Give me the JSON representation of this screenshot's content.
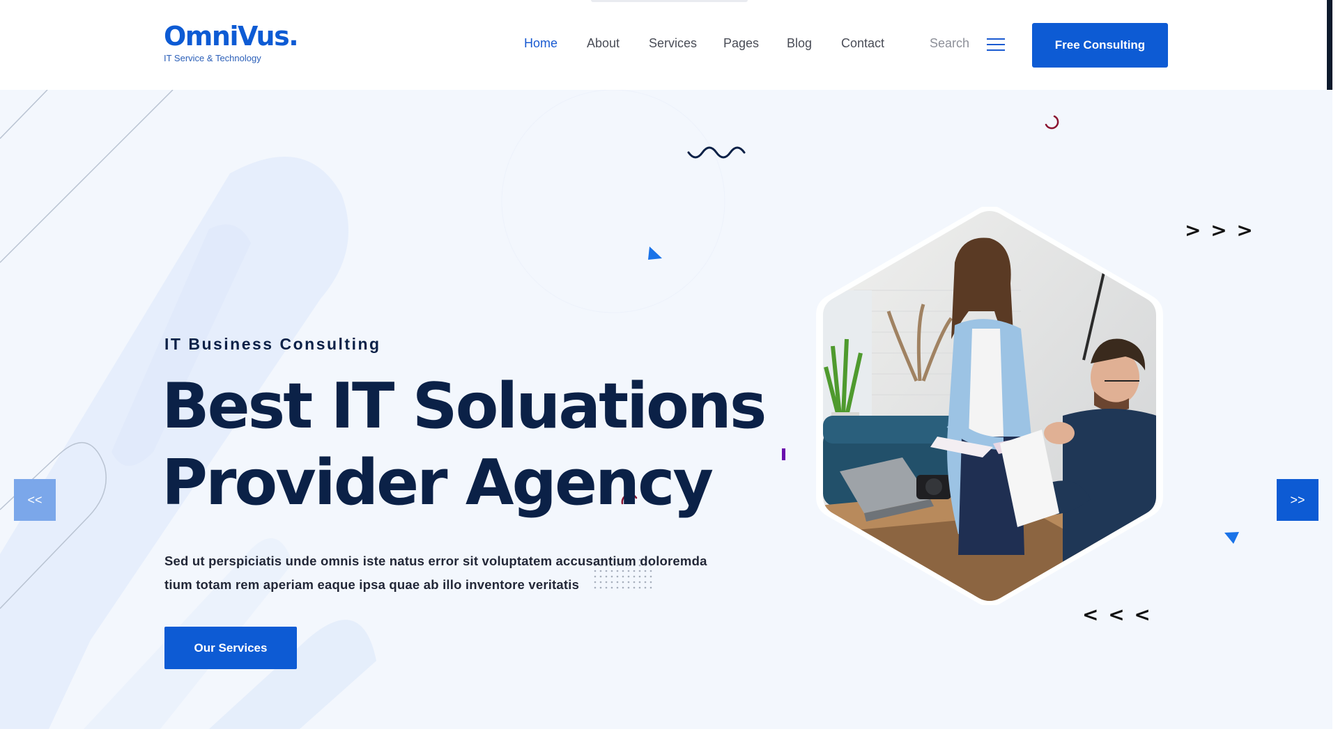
{
  "header": {
    "logo_main": "OmniVus.",
    "logo_sub": "IT Service & Technology",
    "nav": [
      {
        "label": "Home",
        "active": true
      },
      {
        "label": "About",
        "active": false
      },
      {
        "label": "Services",
        "active": false
      },
      {
        "label": "Pages",
        "active": false
      },
      {
        "label": "Blog",
        "active": false
      },
      {
        "label": "Contact",
        "active": false
      }
    ],
    "search_label": "Search",
    "menu_icon": "hamburger-icon",
    "cta_label": "Free Consulting"
  },
  "hero": {
    "tagline": "IT Business Consulting",
    "headline_line1": "Best IT Soluations",
    "headline_line2": "Provider Agency",
    "description": "Sed ut perspiciatis unde omnis iste natus error sit voluptatem accusantium doloremda tium totam rem aperiam eaque ipsa quae ab illo inventore veritatis",
    "button_label": "Our Services",
    "prev_label": "<<",
    "next_label": ">>",
    "chevrons_right": "> > >",
    "chevrons_left": "< < <",
    "image_alt": "team-meeting-photo"
  },
  "colors": {
    "brand": "#0d5bd4",
    "heading": "#0b2147",
    "hero_bg": "#f3f7fd"
  }
}
